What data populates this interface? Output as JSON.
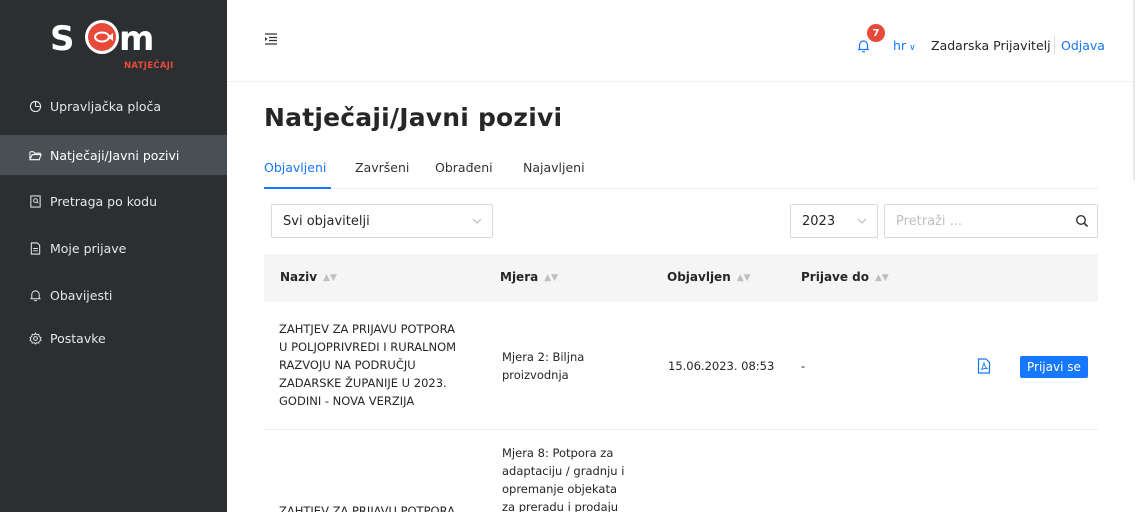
{
  "brand": {
    "logo_text": "SOM",
    "logo_subtitle": "NATJEČAJI",
    "accent_color": "#e84a3a"
  },
  "sidebar": {
    "items": [
      {
        "label": "Upravljačka ploča",
        "icon": "dashboard-icon",
        "active": false
      },
      {
        "label": "Natječaji/Javni pozivi",
        "icon": "folder-open-icon",
        "active": true
      },
      {
        "label": "Pretraga po kodu",
        "icon": "document-search-icon",
        "active": false
      },
      {
        "label": "Moje prijave",
        "icon": "file-icon",
        "active": false
      },
      {
        "label": "Obavijesti",
        "icon": "bell-icon",
        "active": false
      },
      {
        "label": "Postavke",
        "icon": "gear-icon",
        "active": false
      }
    ]
  },
  "header": {
    "notifications_count": "7",
    "language": "hr",
    "user_name": "Zadarska Prijavitelj",
    "logout_label": "Odjava"
  },
  "main": {
    "title": "Natječaji/Javni pozivi",
    "tabs": [
      {
        "label": "Objavljeni",
        "active": true
      },
      {
        "label": "Završeni",
        "active": false
      },
      {
        "label": "Obrađeni",
        "active": false
      },
      {
        "label": "Najavljeni",
        "active": false
      }
    ],
    "filters": {
      "publisher": "Svi objavitelji",
      "year": "2023",
      "search_placeholder": "Pretraži ..."
    },
    "table": {
      "columns": [
        "Naziv",
        "Mjera",
        "Objavljen",
        "Prijave do"
      ],
      "rows": [
        {
          "name_lines": [
            "Zahtjev za prijavu potpora",
            "u poljoprivredi i ruralnom",
            "razvoju na području",
            "Zadarske županije u 2023.",
            "godini - NOVA VERZIJA"
          ],
          "measure_lines": [
            "Mjera 2: Biljna",
            "proizvodnja"
          ],
          "published": "15.06.2023. 08:53",
          "deadline": "-",
          "apply_label": "Prijavi se"
        },
        {
          "name_lines": [
            "Zahtjev za prijavu potpora"
          ],
          "measure_lines": [
            "Mjera 8: Potpora za",
            "adaptaciju / gradnju i",
            "opremanje objekata",
            "za preradu i prodaju"
          ],
          "published": "",
          "deadline": "",
          "apply_label": ""
        }
      ]
    }
  }
}
